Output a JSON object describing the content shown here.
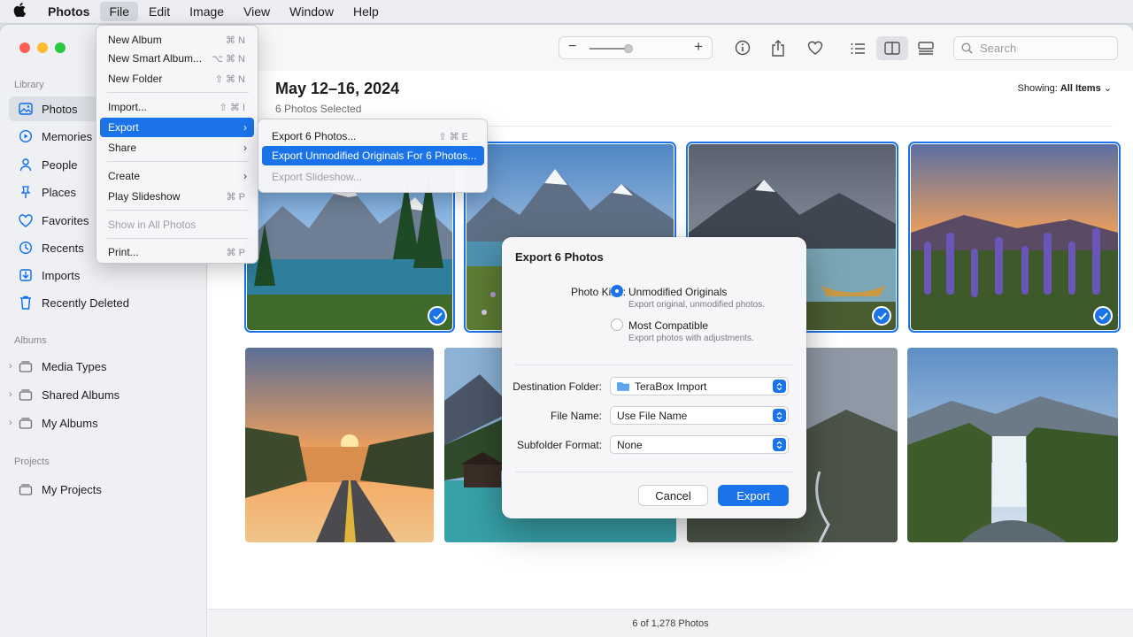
{
  "menubar": {
    "app": "Photos",
    "items": [
      "File",
      "Edit",
      "Image",
      "View",
      "Window",
      "Help"
    ]
  },
  "sidebar": {
    "library_heading": "Library",
    "library_items": [
      "Photos",
      "Memories",
      "People",
      "Places",
      "Favorites",
      "Recents",
      "Imports",
      "Recently Deleted"
    ],
    "albums_heading": "Albums",
    "album_items": [
      "Media Types",
      "Shared Albums",
      "My Albums"
    ],
    "projects_heading": "Projects",
    "project_items": [
      "My Projects"
    ]
  },
  "toolbar": {
    "search_placeholder": "Search",
    "zoom_level": 0.55
  },
  "header": {
    "title": "May 12–16, 2024",
    "subtitle": "6 Photos Selected",
    "showing_label": "Showing:",
    "showing_value": "All Items"
  },
  "status": "6 of 1,278 Photos",
  "file_menu": {
    "new_album": "New Album",
    "new_album_sc": "⌘ N",
    "new_smart_album": "New Smart Album...",
    "new_smart_album_sc": "⌥ ⌘ N",
    "new_folder": "New Folder",
    "new_folder_sc": "⇧ ⌘ N",
    "import": "Import...",
    "import_sc": "⇧ ⌘ I",
    "export": "Export",
    "share": "Share",
    "create": "Create",
    "play_slideshow": "Play Slideshow",
    "play_slideshow_sc": "⌘ P",
    "show_all": "Show in All Photos",
    "print": "Print...",
    "print_sc": "⌘ P"
  },
  "export_submenu": {
    "export_photos": "Export 6 Photos...",
    "export_photos_sc": "⇧ ⌘ E",
    "export_originals": "Export Unmodified Originals For 6 Photos...",
    "export_slideshow": "Export Slideshow..."
  },
  "dialog": {
    "title": "Export 6 Photos",
    "photo_kind_label": "Photo Kind:",
    "opt1": "Unmodified Originals",
    "opt1_desc": "Export original, unmodified photos.",
    "opt2": "Most Compatible",
    "opt2_desc": "Export photos with adjustments.",
    "dest_label": "Destination Folder:",
    "dest_value": "TeraBox Import",
    "filename_label": "File Name:",
    "filename_value": "Use File Name",
    "subfolder_label": "Subfolder Format:",
    "subfolder_value": "None",
    "cancel": "Cancel",
    "export": "Export"
  },
  "colors": {
    "accent": "#1a73e8"
  }
}
